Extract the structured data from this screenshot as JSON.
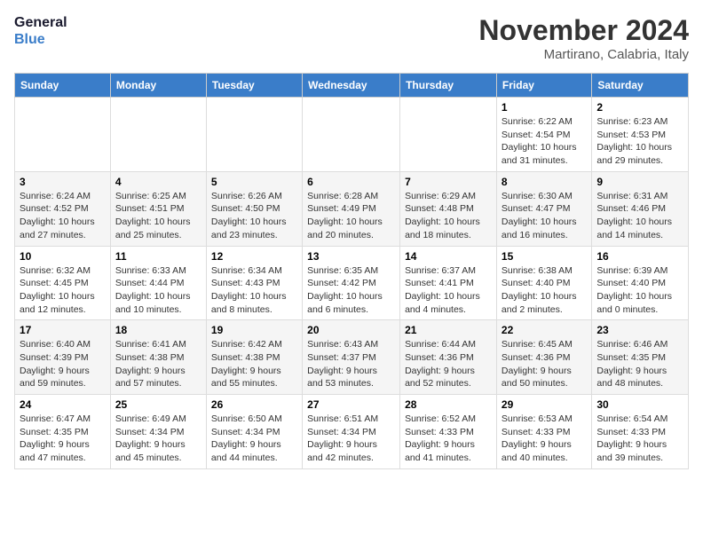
{
  "logo": {
    "line1": "General",
    "line2": "Blue"
  },
  "title": "November 2024",
  "location": "Martirano, Calabria, Italy",
  "weekdays": [
    "Sunday",
    "Monday",
    "Tuesday",
    "Wednesday",
    "Thursday",
    "Friday",
    "Saturday"
  ],
  "weeks": [
    [
      {
        "day": "",
        "info": ""
      },
      {
        "day": "",
        "info": ""
      },
      {
        "day": "",
        "info": ""
      },
      {
        "day": "",
        "info": ""
      },
      {
        "day": "",
        "info": ""
      },
      {
        "day": "1",
        "info": "Sunrise: 6:22 AM\nSunset: 4:54 PM\nDaylight: 10 hours\nand 31 minutes."
      },
      {
        "day": "2",
        "info": "Sunrise: 6:23 AM\nSunset: 4:53 PM\nDaylight: 10 hours\nand 29 minutes."
      }
    ],
    [
      {
        "day": "3",
        "info": "Sunrise: 6:24 AM\nSunset: 4:52 PM\nDaylight: 10 hours\nand 27 minutes."
      },
      {
        "day": "4",
        "info": "Sunrise: 6:25 AM\nSunset: 4:51 PM\nDaylight: 10 hours\nand 25 minutes."
      },
      {
        "day": "5",
        "info": "Sunrise: 6:26 AM\nSunset: 4:50 PM\nDaylight: 10 hours\nand 23 minutes."
      },
      {
        "day": "6",
        "info": "Sunrise: 6:28 AM\nSunset: 4:49 PM\nDaylight: 10 hours\nand 20 minutes."
      },
      {
        "day": "7",
        "info": "Sunrise: 6:29 AM\nSunset: 4:48 PM\nDaylight: 10 hours\nand 18 minutes."
      },
      {
        "day": "8",
        "info": "Sunrise: 6:30 AM\nSunset: 4:47 PM\nDaylight: 10 hours\nand 16 minutes."
      },
      {
        "day": "9",
        "info": "Sunrise: 6:31 AM\nSunset: 4:46 PM\nDaylight: 10 hours\nand 14 minutes."
      }
    ],
    [
      {
        "day": "10",
        "info": "Sunrise: 6:32 AM\nSunset: 4:45 PM\nDaylight: 10 hours\nand 12 minutes."
      },
      {
        "day": "11",
        "info": "Sunrise: 6:33 AM\nSunset: 4:44 PM\nDaylight: 10 hours\nand 10 minutes."
      },
      {
        "day": "12",
        "info": "Sunrise: 6:34 AM\nSunset: 4:43 PM\nDaylight: 10 hours\nand 8 minutes."
      },
      {
        "day": "13",
        "info": "Sunrise: 6:35 AM\nSunset: 4:42 PM\nDaylight: 10 hours\nand 6 minutes."
      },
      {
        "day": "14",
        "info": "Sunrise: 6:37 AM\nSunset: 4:41 PM\nDaylight: 10 hours\nand 4 minutes."
      },
      {
        "day": "15",
        "info": "Sunrise: 6:38 AM\nSunset: 4:40 PM\nDaylight: 10 hours\nand 2 minutes."
      },
      {
        "day": "16",
        "info": "Sunrise: 6:39 AM\nSunset: 4:40 PM\nDaylight: 10 hours\nand 0 minutes."
      }
    ],
    [
      {
        "day": "17",
        "info": "Sunrise: 6:40 AM\nSunset: 4:39 PM\nDaylight: 9 hours\nand 59 minutes."
      },
      {
        "day": "18",
        "info": "Sunrise: 6:41 AM\nSunset: 4:38 PM\nDaylight: 9 hours\nand 57 minutes."
      },
      {
        "day": "19",
        "info": "Sunrise: 6:42 AM\nSunset: 4:38 PM\nDaylight: 9 hours\nand 55 minutes."
      },
      {
        "day": "20",
        "info": "Sunrise: 6:43 AM\nSunset: 4:37 PM\nDaylight: 9 hours\nand 53 minutes."
      },
      {
        "day": "21",
        "info": "Sunrise: 6:44 AM\nSunset: 4:36 PM\nDaylight: 9 hours\nand 52 minutes."
      },
      {
        "day": "22",
        "info": "Sunrise: 6:45 AM\nSunset: 4:36 PM\nDaylight: 9 hours\nand 50 minutes."
      },
      {
        "day": "23",
        "info": "Sunrise: 6:46 AM\nSunset: 4:35 PM\nDaylight: 9 hours\nand 48 minutes."
      }
    ],
    [
      {
        "day": "24",
        "info": "Sunrise: 6:47 AM\nSunset: 4:35 PM\nDaylight: 9 hours\nand 47 minutes."
      },
      {
        "day": "25",
        "info": "Sunrise: 6:49 AM\nSunset: 4:34 PM\nDaylight: 9 hours\nand 45 minutes."
      },
      {
        "day": "26",
        "info": "Sunrise: 6:50 AM\nSunset: 4:34 PM\nDaylight: 9 hours\nand 44 minutes."
      },
      {
        "day": "27",
        "info": "Sunrise: 6:51 AM\nSunset: 4:34 PM\nDaylight: 9 hours\nand 42 minutes."
      },
      {
        "day": "28",
        "info": "Sunrise: 6:52 AM\nSunset: 4:33 PM\nDaylight: 9 hours\nand 41 minutes."
      },
      {
        "day": "29",
        "info": "Sunrise: 6:53 AM\nSunset: 4:33 PM\nDaylight: 9 hours\nand 40 minutes."
      },
      {
        "day": "30",
        "info": "Sunrise: 6:54 AM\nSunset: 4:33 PM\nDaylight: 9 hours\nand 39 minutes."
      }
    ]
  ]
}
